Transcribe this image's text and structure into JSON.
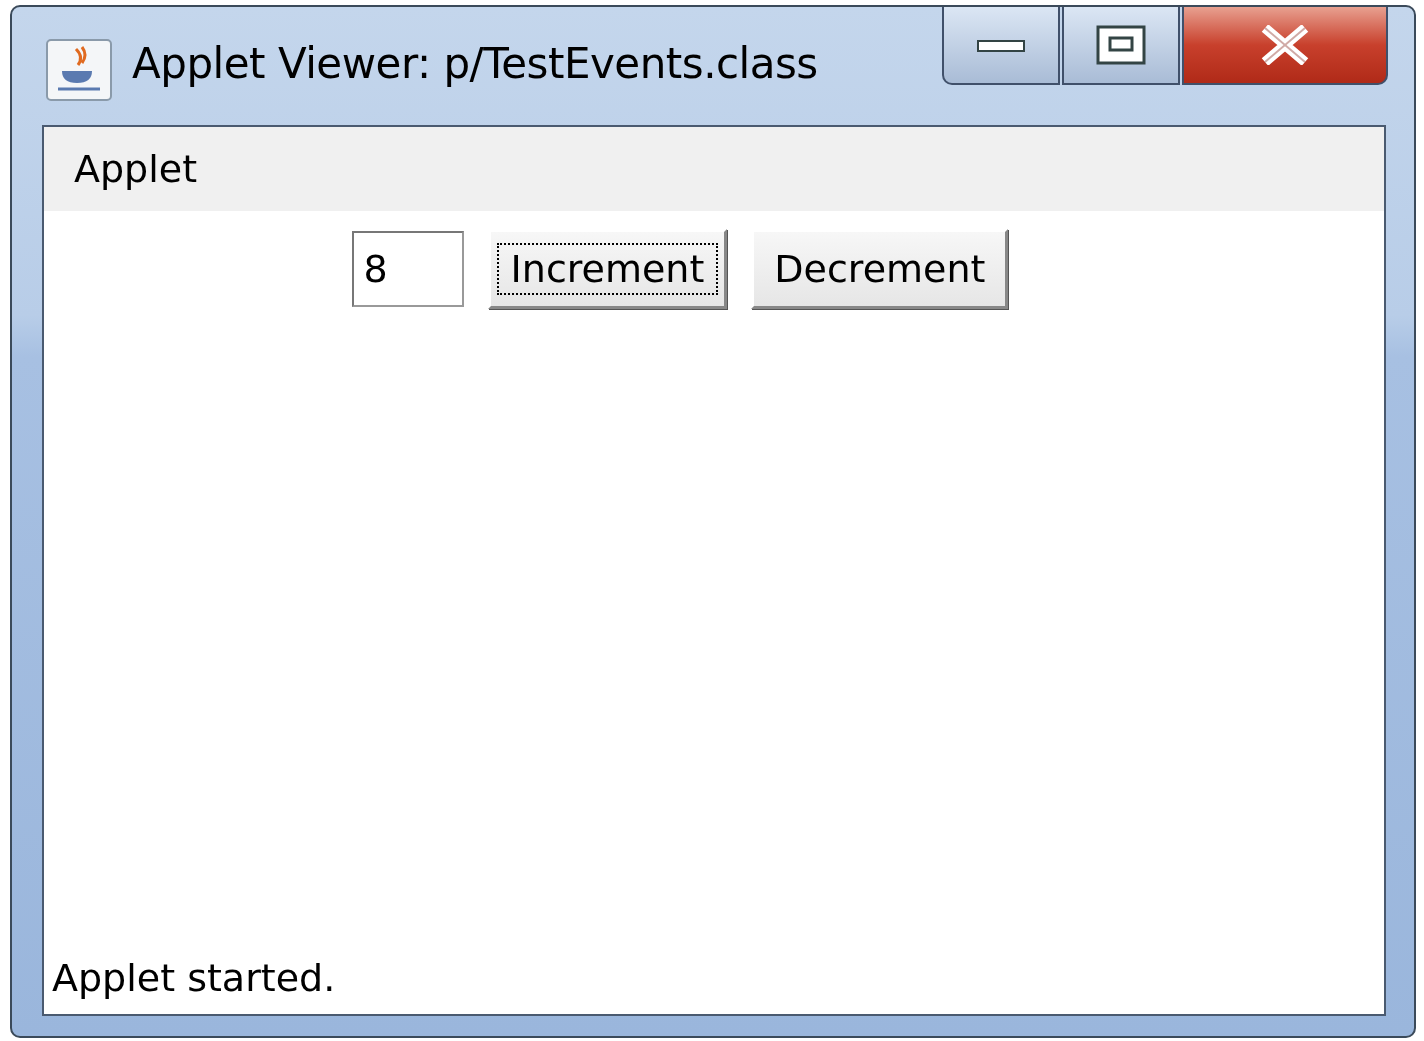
{
  "window": {
    "title": "Applet Viewer: p/TestEvents.class"
  },
  "menu": [
    {
      "label": "Applet"
    }
  ],
  "controls": [
    {
      "kind": "field",
      "value": "8"
    },
    {
      "kind": "button",
      "label": "Increment",
      "focused": true
    },
    {
      "kind": "button",
      "label": "Decrement",
      "focused": false
    }
  ],
  "status_bar": "Applet started."
}
